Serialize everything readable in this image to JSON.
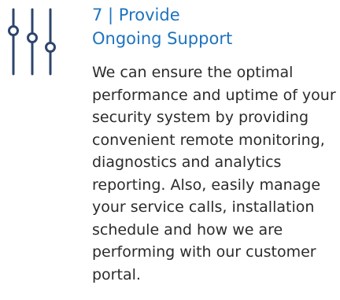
{
  "step": {
    "title_line1": "7 | Provide",
    "title_line2": "Ongoing Support",
    "description": "We can ensure the optimal performance and uptime of your security system by providing convenient remote monitoring, diagnostics and analytics reporting. Also, easily manage your service calls, installation schedule and how we are performing with our customer portal.",
    "icon": "sliders-icon"
  },
  "colors": {
    "icon_stroke": "#2e466e",
    "title": "#1e73be",
    "body_text": "#2b2b2b"
  }
}
